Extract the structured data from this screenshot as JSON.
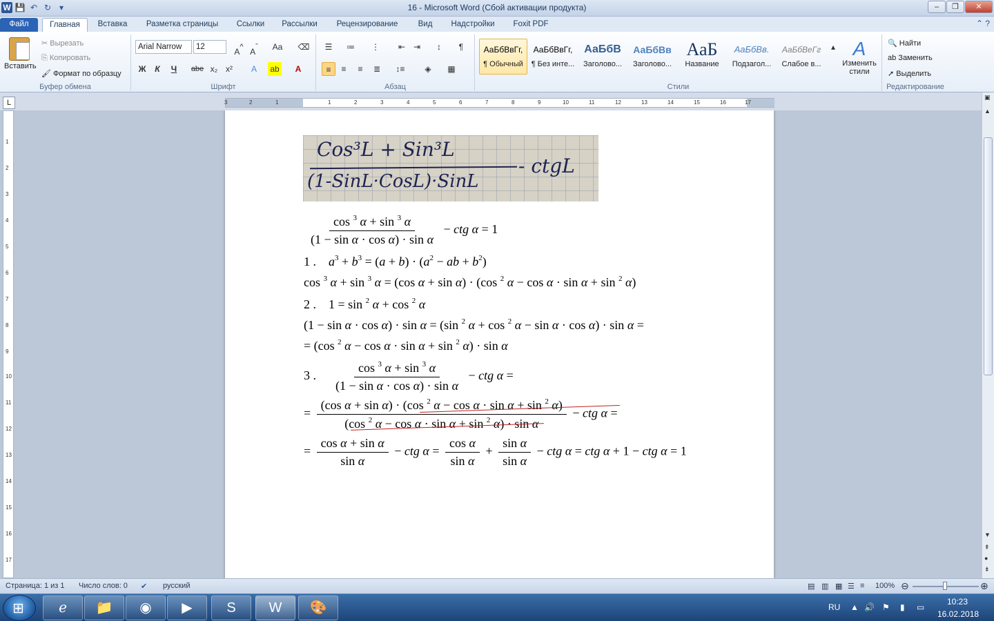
{
  "titlebar": {
    "title": "16  -  Microsoft Word (Сбой активации продукта)"
  },
  "tabs": [
    "Файл",
    "Главная",
    "Вставка",
    "Разметка страницы",
    "Ссылки",
    "Рассылки",
    "Рецензирование",
    "Вид",
    "Надстройки",
    "Foxit PDF"
  ],
  "ribbon": {
    "clipboard": {
      "paste": "Вставить",
      "cut": "Вырезать",
      "copy": "Копировать",
      "format_painter": "Формат по образцу",
      "label": "Буфер обмена"
    },
    "font": {
      "family": "Arial Narrow",
      "size": "12",
      "label": "Шрифт",
      "bold": "Ж",
      "italic": "К",
      "underline": "Ч",
      "strike": "abe"
    },
    "paragraph": {
      "label": "Абзац"
    },
    "styles": {
      "label": "Стили",
      "items": [
        {
          "sample": "АаБбВвГг,",
          "name": "¶ Обычный"
        },
        {
          "sample": "АаБбВвГг,",
          "name": "¶ Без инте..."
        },
        {
          "sample": "АаБбВ",
          "name": "Заголово..."
        },
        {
          "sample": "АаБбВв",
          "name": "Заголово..."
        },
        {
          "sample": "АаБ",
          "name": "Название"
        },
        {
          "sample": "АаБбВв.",
          "name": "Подзагол..."
        },
        {
          "sample": "АаБбВеГг",
          "name": "Слабое в..."
        }
      ],
      "change": "Изменить стили"
    },
    "editing": {
      "find": "Найти",
      "replace": "Заменить",
      "select": "Выделить",
      "label": "Редактирование"
    }
  },
  "ruler": {
    "numbers": [
      "3",
      "2",
      "1",
      "1",
      "2",
      "3",
      "4",
      "5",
      "6",
      "7",
      "8",
      "9",
      "10",
      "11",
      "12",
      "13",
      "14",
      "15",
      "16",
      "17"
    ]
  },
  "document": {
    "handwritten": {
      "numerator": "Cos³L + Sin³L",
      "denominator": "(1-SinL·CosL)·SinL",
      "suffix": "- ctgL"
    },
    "step1_label": "1 .",
    "step2_label": "2 .",
    "step3_label": "3 ."
  },
  "statusbar": {
    "page": "Страница: 1 из 1",
    "words": "Число слов: 0",
    "language": "русский",
    "zoom": "100%"
  },
  "taskbar": {
    "lang": "RU",
    "time": "10:23",
    "date": "16.02.2018"
  }
}
